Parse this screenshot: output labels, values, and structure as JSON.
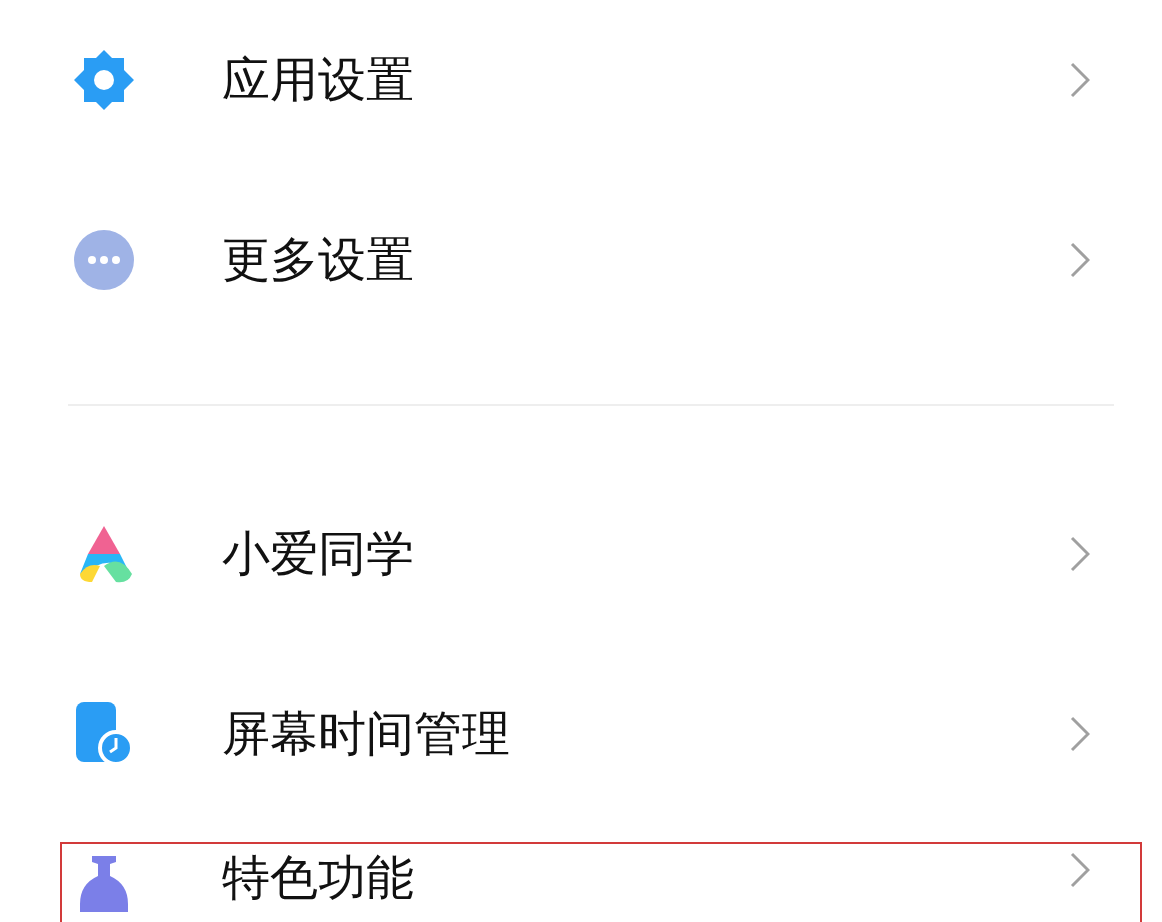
{
  "groups": [
    {
      "items": [
        {
          "label": "应用设置",
          "kind": "gear",
          "highlighted": false
        },
        {
          "label": "更多设置",
          "kind": "dots",
          "highlighted": false
        }
      ]
    },
    {
      "items": [
        {
          "label": "小爱同学",
          "kind": "assistant",
          "highlighted": false
        },
        {
          "label": "屏幕时间管理",
          "kind": "screen-time",
          "highlighted": false
        },
        {
          "label": "特色功能",
          "kind": "vase",
          "highlighted": true
        }
      ]
    }
  ]
}
